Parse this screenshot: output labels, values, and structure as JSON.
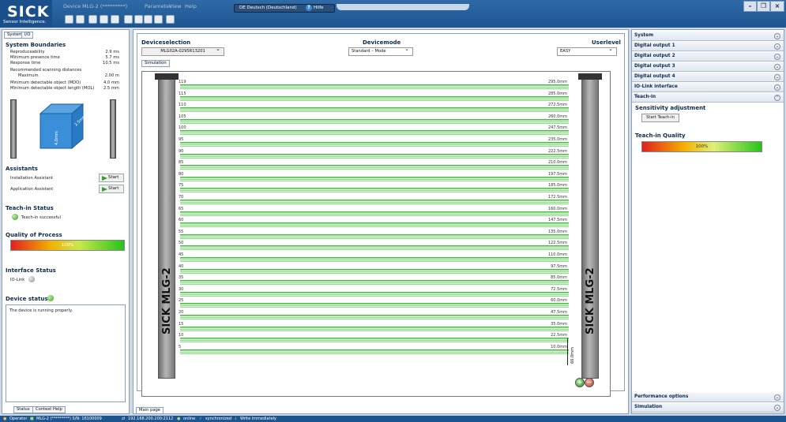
{
  "app": {
    "logo": "SICK",
    "tagline": "Sensor Intelligence.",
    "menu": [
      "Device",
      "MLG-2 (*********)",
      "Parameter",
      "View",
      "Help"
    ],
    "language": "DE Deutsch (Deutschland)",
    "help": "Hilfe"
  },
  "left": {
    "tabs": [
      "System",
      "I/O"
    ],
    "boundaries_title": "System Boundaries",
    "boundaries": [
      {
        "k": "Reproduceability",
        "v": "2.9 ms"
      },
      {
        "k": "Minimum presence time",
        "v": "5.7 ms"
      },
      {
        "k": "Response time",
        "v": "10.5 ms"
      }
    ],
    "rec_label": "Recommended scanning distances",
    "max_label": "Maximum",
    "max_value": "2.00 m",
    "mdo_label": "Minimum detectable object (MDO)",
    "mdo_value": "4.0 mm",
    "mol_label": "Minimum detectable object length (MOL)",
    "mol_value": "2.5 mm",
    "cube_mdo": "4.0mm",
    "cube_mol": "2.5mm",
    "assistants_title": "Assistants",
    "installation": "Installation Assistant",
    "application": "Application Assistant",
    "start": "Start",
    "teachin_title": "Teach-in Status",
    "teachin_status": "Teach-in successful",
    "quality_title": "Quality of Process",
    "quality_value": "100%",
    "quality_fraction": 1.0,
    "interface_title": "Interface Status",
    "iolink": "IO-Link",
    "device_status_title": "Device status",
    "device_message": "The device is running properly.",
    "bottom_tabs": [
      "Status",
      "Context Help"
    ]
  },
  "center": {
    "deviceselection_label": "Deviceselection",
    "device": "MLG02A-0295R13201",
    "devicemode_label": "Devicemode",
    "mode": "Standard – Mode",
    "userlevel_label": "Userlevel",
    "userlevel": "EASY",
    "sim_tab": "Simulation",
    "main_tab": "Main page",
    "beams": [
      {
        "n": "119",
        "mm": "295.0mm"
      },
      {
        "n": "115",
        "mm": "285.0mm"
      },
      {
        "n": "110",
        "mm": "272.5mm"
      },
      {
        "n": "105",
        "mm": "260.0mm"
      },
      {
        "n": "100",
        "mm": "247.5mm"
      },
      {
        "n": "95",
        "mm": "235.0mm"
      },
      {
        "n": "90",
        "mm": "222.5mm"
      },
      {
        "n": "85",
        "mm": "210.0mm"
      },
      {
        "n": "80",
        "mm": "197.5mm"
      },
      {
        "n": "75",
        "mm": "185.0mm"
      },
      {
        "n": "70",
        "mm": "172.5mm"
      },
      {
        "n": "65",
        "mm": "160.0mm"
      },
      {
        "n": "60",
        "mm": "147.5mm"
      },
      {
        "n": "55",
        "mm": "135.0mm"
      },
      {
        "n": "50",
        "mm": "122.5mm"
      },
      {
        "n": "45",
        "mm": "110.0mm"
      },
      {
        "n": "40",
        "mm": "97.5mm"
      },
      {
        "n": "35",
        "mm": "85.0mm"
      },
      {
        "n": "30",
        "mm": "72.5mm"
      },
      {
        "n": "25",
        "mm": "60.0mm"
      },
      {
        "n": "20",
        "mm": "47.5mm"
      },
      {
        "n": "15",
        "mm": "35.0mm"
      },
      {
        "n": "10",
        "mm": "22.5mm"
      },
      {
        "n": "5",
        "mm": "10.0mm"
      }
    ],
    "offset_label": "60.0mm",
    "pillar_label": "SICK MLG-2"
  },
  "right": {
    "sections": [
      "System",
      "Digital output 1",
      "Digital output 2",
      "Digital output 3",
      "Digital output 4",
      "IO-Link interface",
      "Teach-in"
    ],
    "sensitivity_title": "Sensitivity adjustment",
    "start_teachin": "Start Teach-in",
    "teachin_quality_title": "Teach-in Quality",
    "teachin_quality_value": "100%",
    "teachin_quality_fraction": 1.0,
    "bottom_sections": [
      "Performance options",
      "Simulation"
    ]
  },
  "statusbar": {
    "operator": "Operator",
    "device": "MLG-2 (*********) S/N: 16100009",
    "ip": "192.168.200.200:2112",
    "online": "online",
    "sync": "synchronized",
    "write": "Write immediately"
  }
}
